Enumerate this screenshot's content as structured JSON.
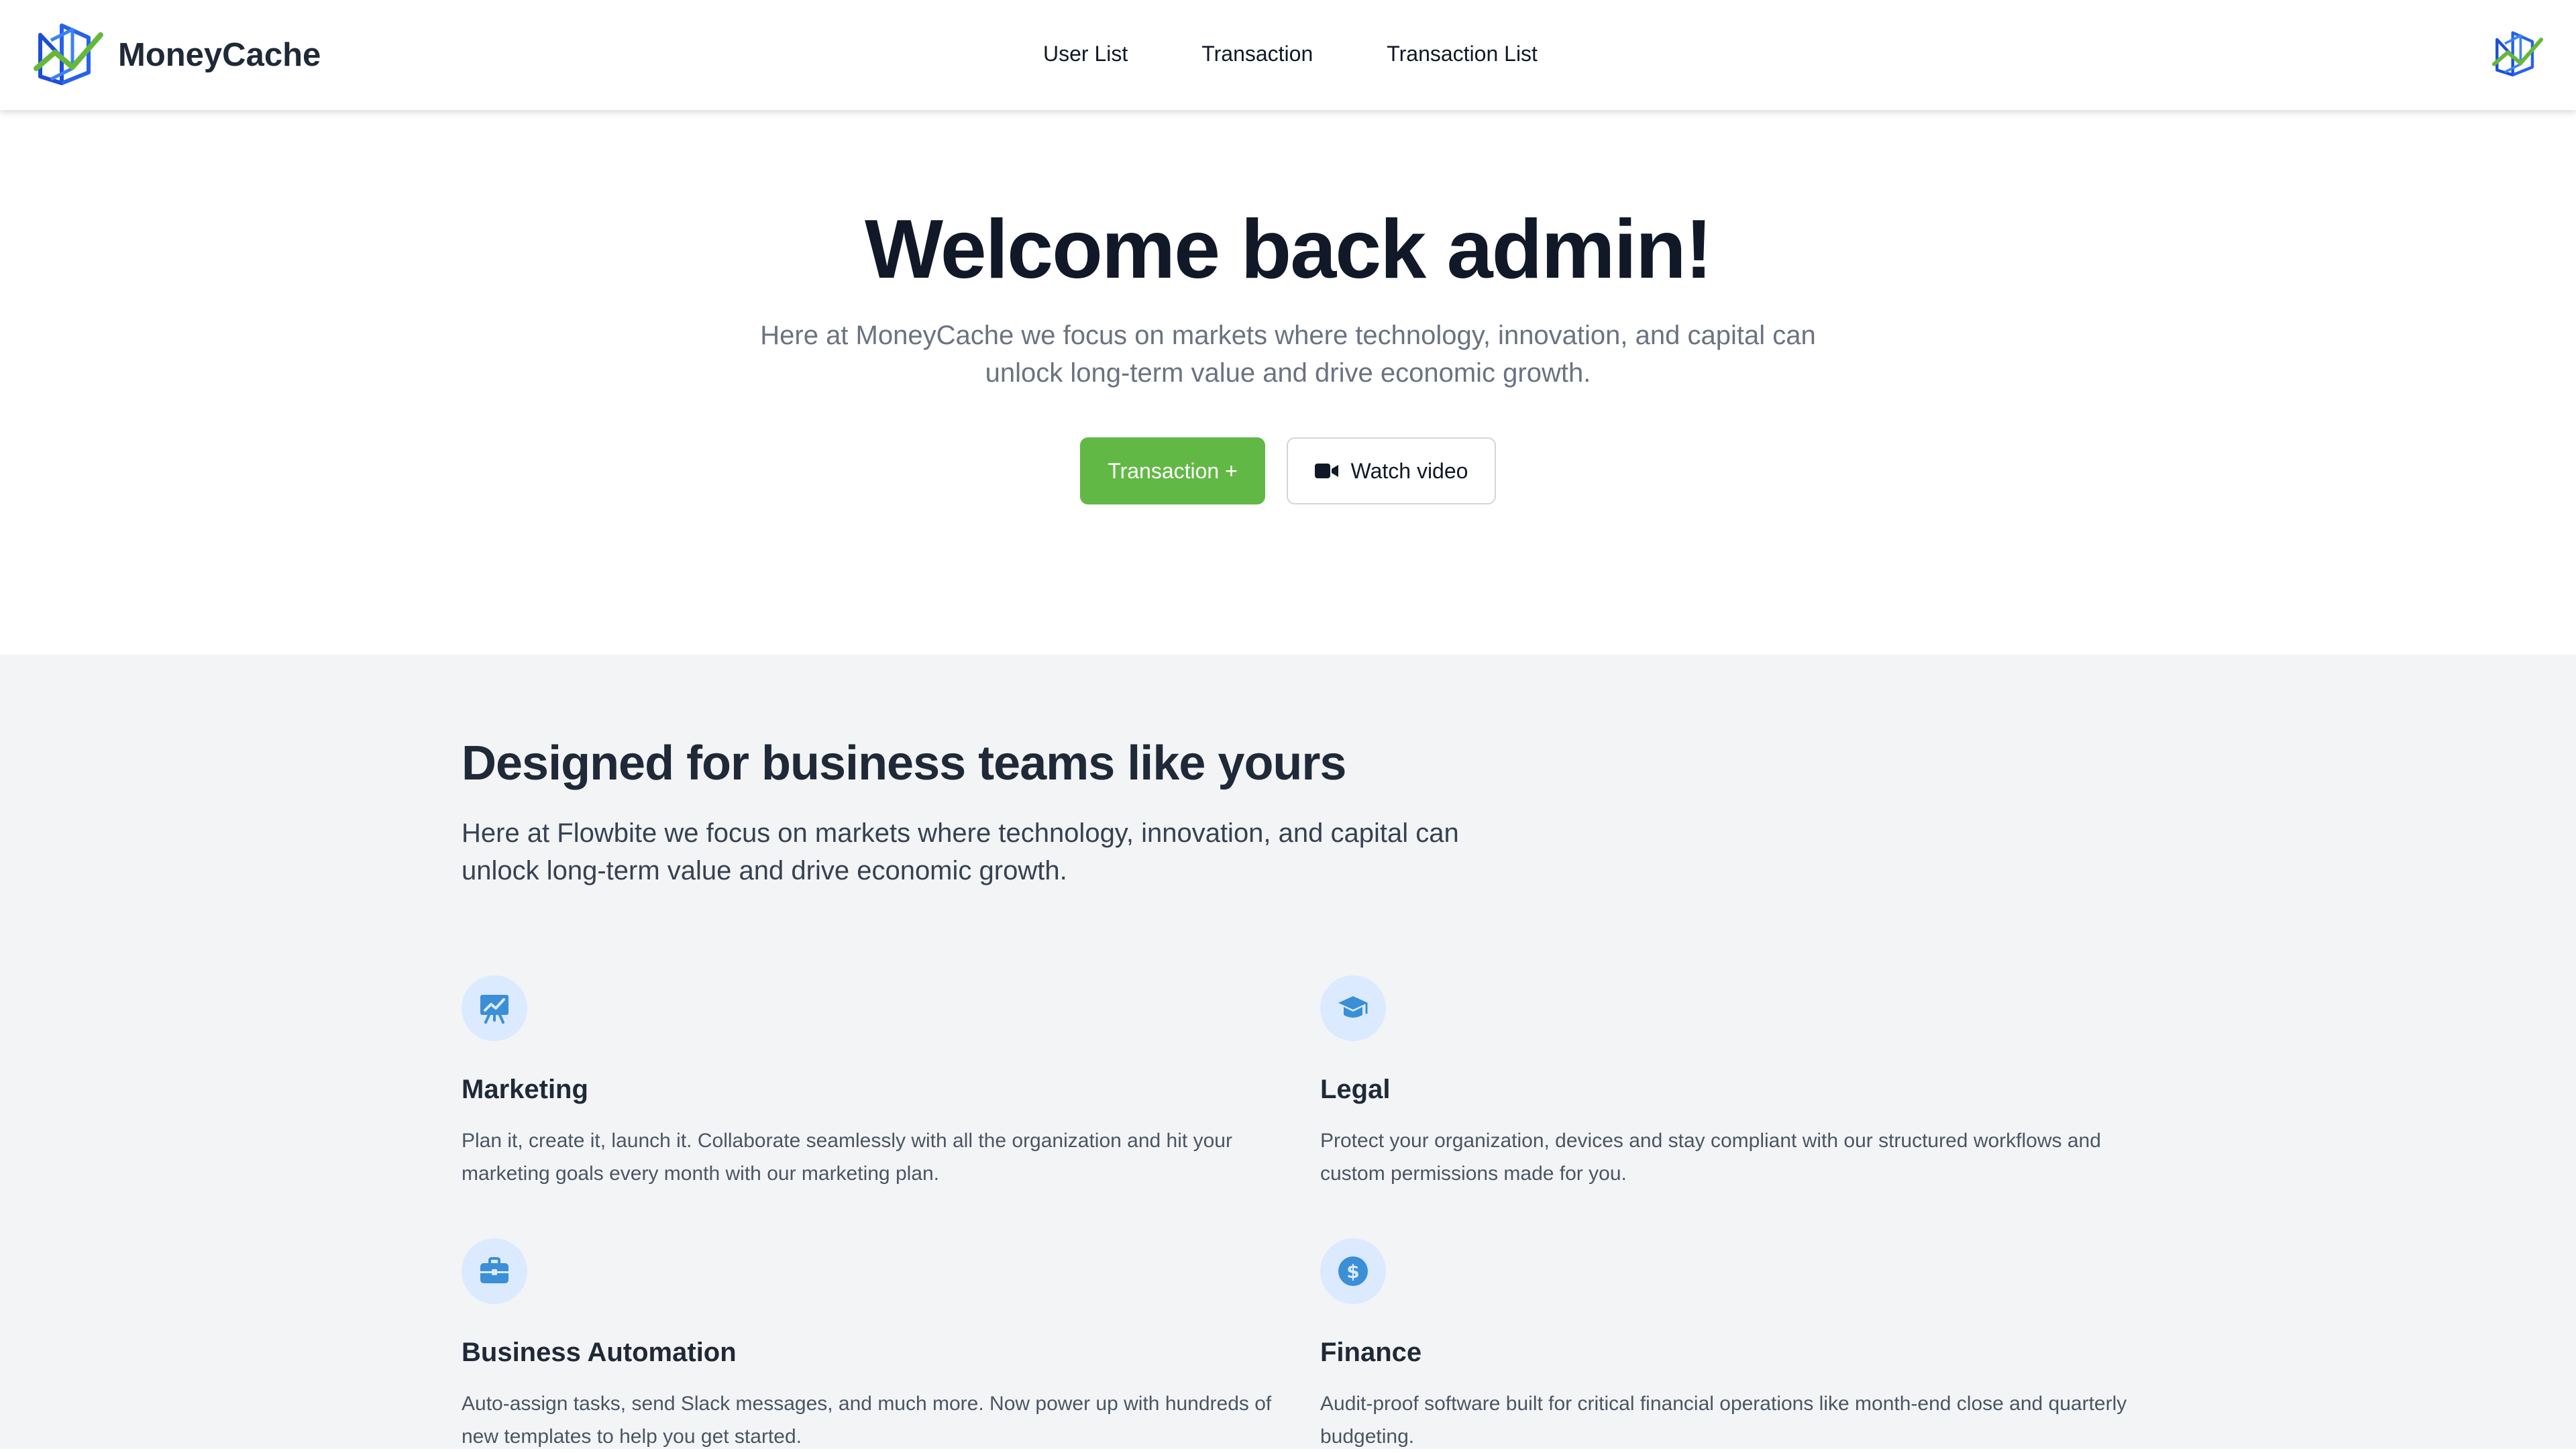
{
  "header": {
    "brand_name": "MoneyCache",
    "nav": [
      {
        "label": "User List"
      },
      {
        "label": "Transaction"
      },
      {
        "label": "Transaction List"
      }
    ]
  },
  "hero": {
    "title": "Welcome back admin!",
    "subtitle": "Here at MoneyCache we focus on markets where technology, innovation, and capital can unlock long-term value and drive economic growth.",
    "primary_button": "Transaction +",
    "secondary_button": "Watch video"
  },
  "features": {
    "title": "Designed for business teams like yours",
    "subtitle": "Here at Flowbite we focus on markets where technology, innovation, and capital can unlock long-term value and drive economic growth.",
    "items": [
      {
        "icon": "presentation-chart-icon",
        "title": "Marketing",
        "text": "Plan it, create it, launch it. Collaborate seamlessly with all the organization and hit your marketing goals every month with our marketing plan."
      },
      {
        "icon": "graduation-cap-icon",
        "title": "Legal",
        "text": "Protect your organization, devices and stay compliant with our structured workflows and custom permissions made for you."
      },
      {
        "icon": "briefcase-icon",
        "title": "Business Automation",
        "text": "Auto-assign tasks, send Slack messages, and much more. Now power up with hundreds of new templates to help you get started."
      },
      {
        "icon": "dollar-circle-icon",
        "title": "Finance",
        "text": "Audit-proof software built for critical financial operations like month-end close and quarterly budgeting."
      }
    ]
  },
  "colors": {
    "primary_green": "#62b845",
    "logo_blue": "#2563eb",
    "logo_green": "#65b83a",
    "icon_blue": "#3b8fd6",
    "features_bg": "#f3f4f6"
  }
}
